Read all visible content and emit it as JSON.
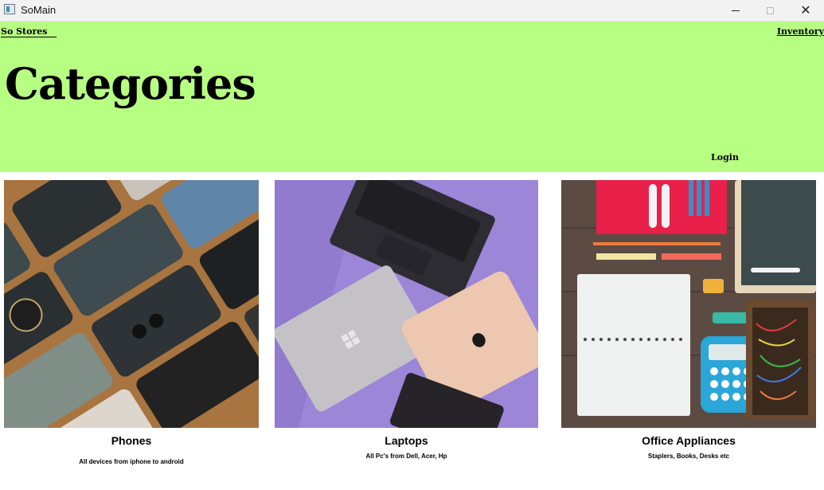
{
  "window": {
    "title": "SoMain"
  },
  "header": {
    "brand_link": "So Stores",
    "inventory_link": "Inventory",
    "page_title": "Categories",
    "login_link": "Login",
    "background": "#b7ff83"
  },
  "categories": [
    {
      "title": "Phones",
      "description": "All devices from iphone to android"
    },
    {
      "title": "Laptops",
      "description": "All Pc's from Dell, Acer, Hp"
    },
    {
      "title": "Office Appliances",
      "description": "Staplers, Books, Desks etc"
    }
  ]
}
